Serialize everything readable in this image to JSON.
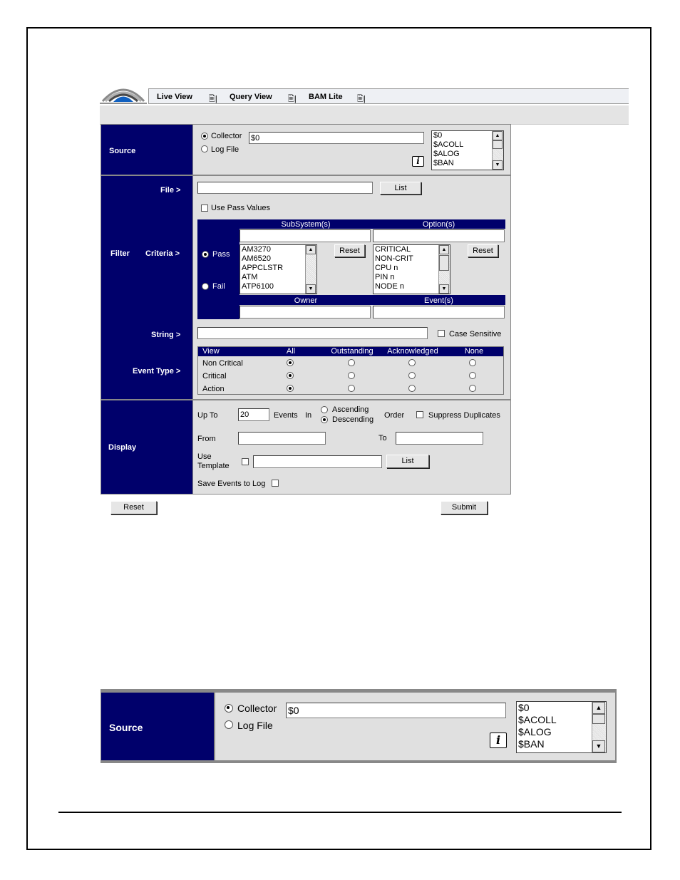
{
  "nav": {
    "items": [
      {
        "label": "Live View"
      },
      {
        "label": "Query View"
      },
      {
        "label": "BAM Lite"
      }
    ],
    "icon_glyph": "🖹|",
    "logo_icon": "arc-logo-icon"
  },
  "form": {
    "source": {
      "label": "Source",
      "collector_label": "Collector",
      "logfile_label": "Log File",
      "collector_value": "$0",
      "list_items": [
        "$0",
        "$ACOLL",
        "$ALOG",
        "$BAN"
      ],
      "info_glyph": "i"
    },
    "file": {
      "label": "File  >",
      "list_button": "List",
      "use_pass_values": "Use Pass Values"
    },
    "criteria": {
      "filter_label": "Filter",
      "criteria_label": "Criteria  >",
      "pass_label": "Pass",
      "fail_label": "Fail",
      "subsystems_header": "SubSystem(s)",
      "options_header": "Option(s)",
      "subsystems": [
        "AM3270",
        "AM6520",
        "APPCLSTR",
        "ATM",
        "ATP6100"
      ],
      "options": [
        "CRITICAL",
        "NON-CRIT",
        "CPU n",
        "PIN n",
        "NODE n"
      ],
      "reset_button": "Reset",
      "owner_header": "Owner",
      "events_header": "Event(s)"
    },
    "string": {
      "label": "String  >",
      "case_sensitive": "Case Sensitive"
    },
    "event_type": {
      "label": "Event Type  >",
      "columns": [
        "View",
        "All",
        "Outstanding",
        "Acknowledged",
        "None"
      ],
      "rows": [
        "Non Critical",
        "Critical",
        "Action"
      ]
    },
    "display": {
      "label": "Display",
      "up_to": "Up To",
      "up_to_value": "20",
      "events": "Events",
      "in": "In",
      "ascending": "Ascending",
      "descending": "Descending",
      "order": "Order",
      "suppress_duplicates": "Suppress Duplicates",
      "from": "From",
      "to": "To",
      "use_template": "Use",
      "use_template2": "Template",
      "list_button": "List",
      "save_events": "Save Events to Log"
    },
    "reset_button": "Reset",
    "submit_button": "Submit"
  },
  "zoom": {
    "source_label": "Source",
    "collector_label": "Collector",
    "logfile_label": "Log File",
    "collector_value": "$0",
    "list_items": [
      "$0",
      "$ACOLL",
      "$ALOG",
      "$BAN"
    ],
    "info_glyph": "i"
  }
}
